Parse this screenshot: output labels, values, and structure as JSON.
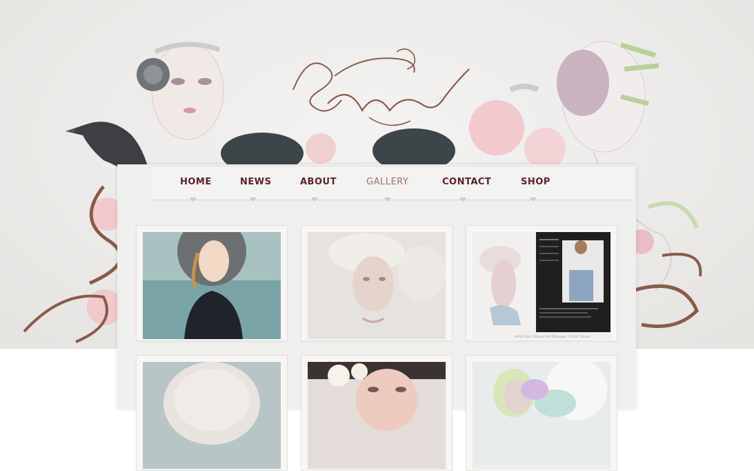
{
  "site": {
    "logo_text": "Bec Winnel"
  },
  "nav": {
    "items": [
      {
        "label": "HOME"
      },
      {
        "label": "NEWS"
      },
      {
        "label": "ABOUT"
      },
      {
        "label": "GALLERY",
        "active": true
      },
      {
        "label": "CONTACT"
      },
      {
        "label": "SHOP"
      }
    ]
  },
  "gallery": {
    "items": [
      {
        "name": "girl-dark-coat-painting"
      },
      {
        "name": "pale-woman-portrait"
      },
      {
        "name": "wrangler-fashion-shot",
        "caption": "Artist Bec Winnel for Wrangler T-shirt Series"
      },
      {
        "name": "white-hair-portrait"
      },
      {
        "name": "flower-girl-portrait"
      },
      {
        "name": "horse-girl-portrait"
      }
    ],
    "watermark": "· · · · · · ·"
  },
  "colors": {
    "nav_text": "#5b2230",
    "nav_active": "#9a6f6a",
    "logo_ink": "#8a5a4a"
  }
}
